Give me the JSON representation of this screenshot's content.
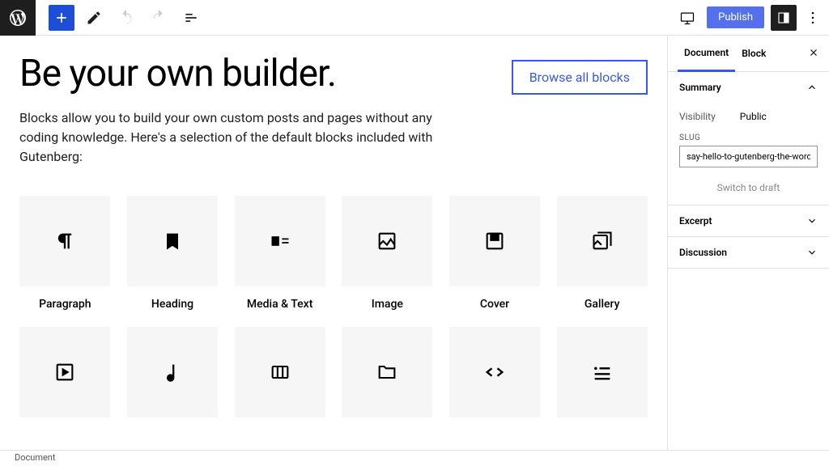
{
  "topbar": {
    "publish_label": "Publish"
  },
  "content": {
    "title": "Be your own builder.",
    "browse_label": "Browse all blocks",
    "description": "Blocks allow you to build your own custom posts and pages without any coding knowledge. Here's a selection of the default blocks included with Gutenberg:",
    "blocks_row1": [
      "Paragraph",
      "Heading",
      "Media & Text",
      "Image",
      "Cover",
      "Gallery"
    ],
    "blocks_row2": [
      "",
      "",
      "",
      "",
      "",
      ""
    ]
  },
  "sidebar": {
    "tabs": {
      "document": "Document",
      "block": "Block"
    },
    "summary": {
      "title": "Summary",
      "visibility_label": "Visibility",
      "visibility_value": "Public",
      "slug_label": "SLUG",
      "slug_value": "say-hello-to-gutenberg-the-wordpress-ed",
      "switch_draft": "Switch to draft"
    },
    "excerpt": {
      "title": "Excerpt"
    },
    "discussion": {
      "title": "Discussion"
    }
  },
  "footer": {
    "breadcrumb": "Document"
  }
}
